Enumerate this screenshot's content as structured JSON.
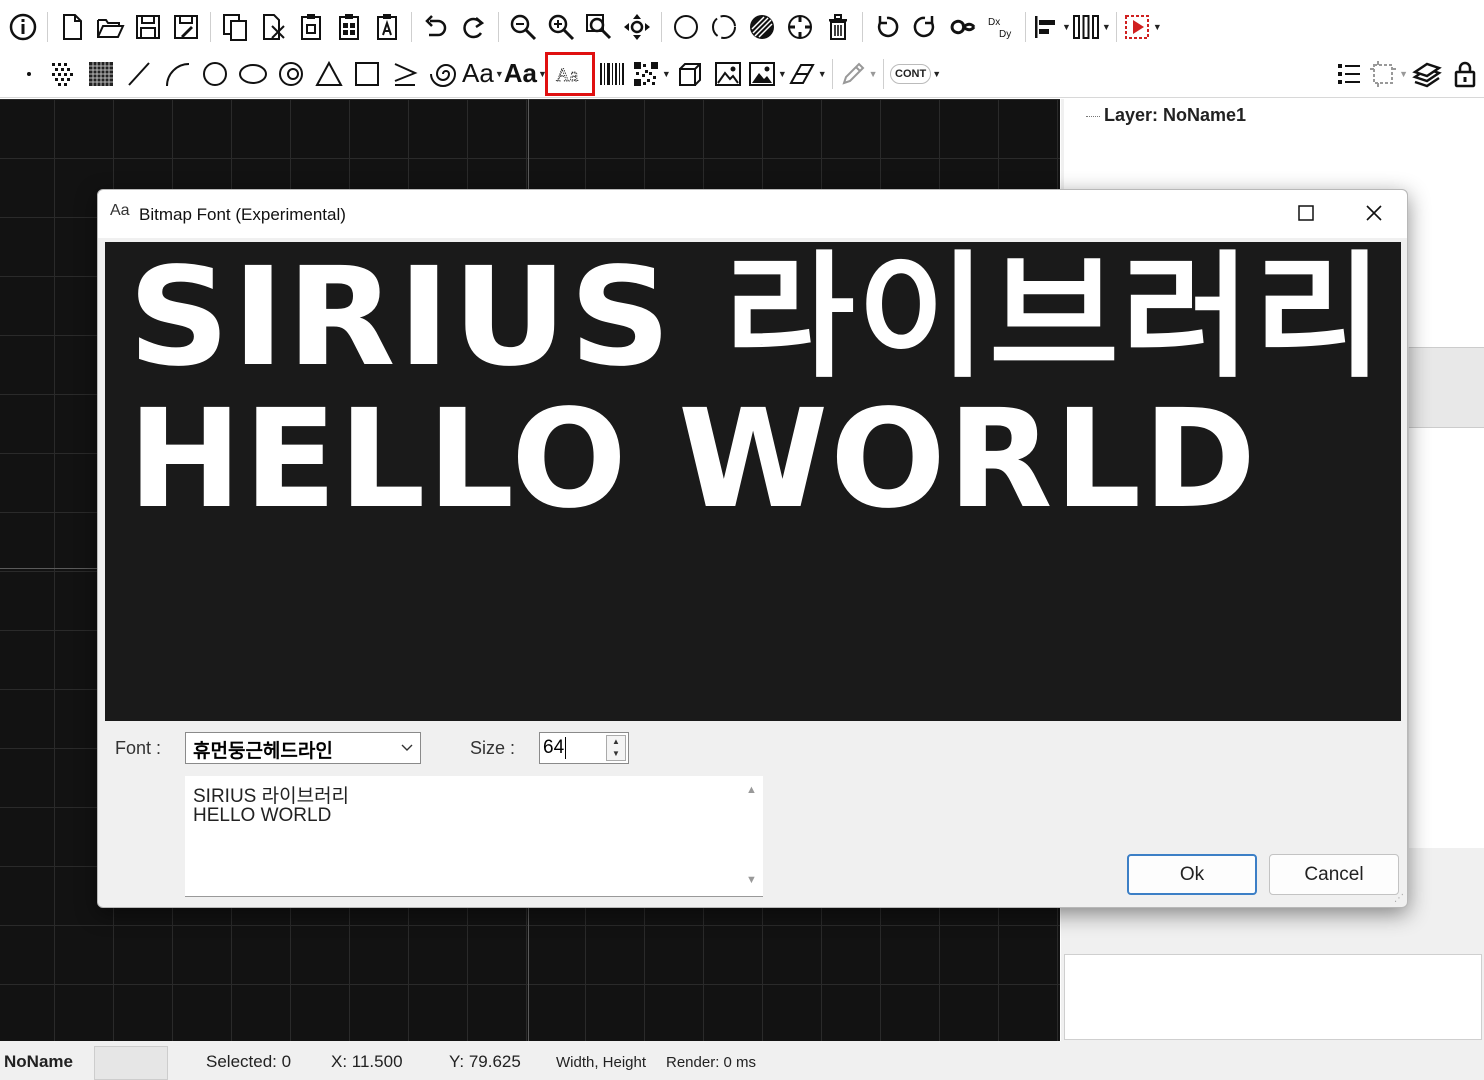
{
  "toolbar2": {
    "text_icon_a": "Aa",
    "text_icon_b": "Aa",
    "cont_label": "CONT"
  },
  "right_panel": {
    "layer_label": "Layer: NoName1"
  },
  "status_bar": {
    "doc_name": "NoName",
    "selected": "Selected: 0",
    "x": "X: 11.500",
    "y": "Y: 79.625",
    "width_height": "Width, Height",
    "render": "Render: 0 ms"
  },
  "dialog": {
    "title_icon": "Aa",
    "title": "Bitmap Font (Experimental)",
    "preview_lines": [
      "SIRIUS 라이브러리",
      "HELLO WORLD"
    ],
    "font_label": "Font :",
    "font_value": "휴먼둥근헤드라인",
    "size_label": "Size :",
    "size_value": "64",
    "text_lines": [
      "SIRIUS 라이브러리",
      "HELLO WORLD"
    ],
    "ok_label": "Ok",
    "cancel_label": "Cancel"
  },
  "colors": {
    "canvas_bg": "#121212",
    "highlight": "#e01010",
    "ok_border": "#3c7fc6"
  }
}
